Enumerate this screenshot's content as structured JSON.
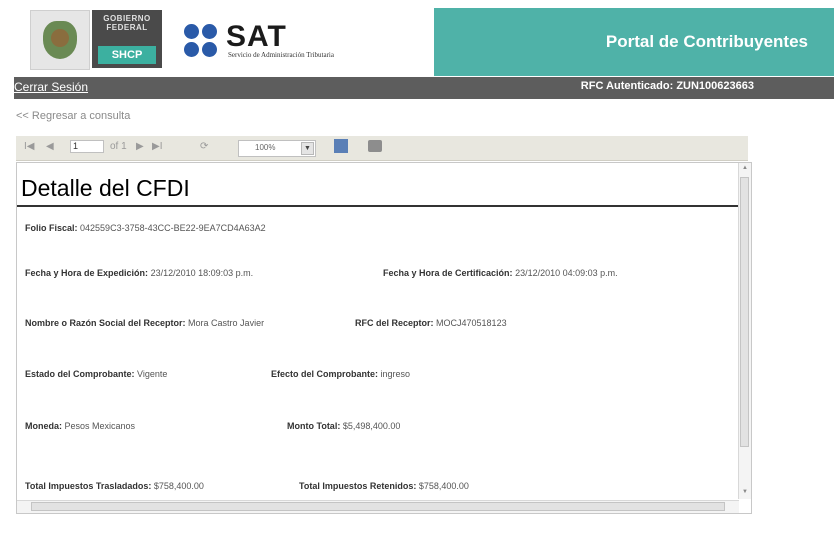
{
  "header": {
    "gov_text": "GOBIERNO FEDERAL",
    "shcp": "SHCP",
    "sat_logo": "SAT",
    "sat_subtitle": "Servicio de Administración Tributaria",
    "portal_title": "Portal de Contribuyentes"
  },
  "auth_bar": {
    "logout": "Cerrar Sesión",
    "rfc_authenticated": "RFC Autenticado: ZUN100623663"
  },
  "back_link": "<< Regresar a consulta",
  "toolbar": {
    "first": "I◀",
    "prev": "◀",
    "page_value": "1",
    "page_of": "of 1",
    "next": "▶",
    "last": "▶I",
    "refresh": "⟳",
    "zoom": "100%",
    "icons": [
      "first-page-icon",
      "prev-page-icon",
      "next-page-icon",
      "last-page-icon",
      "refresh-icon",
      "save-icon",
      "print-icon"
    ]
  },
  "report": {
    "title": "Detalle del CFDI",
    "folio": {
      "label": "Folio Fiscal:",
      "value": "042559C3-3758-43CC-BE22-9EA7CD4A63A2"
    },
    "fecha_expedicion": {
      "label": "Fecha y Hora de Expedición:",
      "value": "23/12/2010 18:09:03 p.m."
    },
    "fecha_certificacion": {
      "label": "Fecha y Hora de Certificación:",
      "value": "23/12/2010 04:09:03 p.m."
    },
    "nombre_receptor": {
      "label": "Nombre o Razón Social del Receptor:",
      "value": "Mora Castro Javier"
    },
    "rfc_receptor": {
      "label": "RFC del Receptor:",
      "value": "MOCJ470518123"
    },
    "estado": {
      "label": "Estado del Comprobante:",
      "value": "Vigente"
    },
    "efecto": {
      "label": "Efecto del Comprobante:",
      "value": "ingreso"
    },
    "moneda": {
      "label": "Moneda:",
      "value": "Pesos Mexicanos"
    },
    "monto": {
      "label": "Monto Total:",
      "value": "$5,498,400.00"
    },
    "traslados": {
      "label": "Total Impuestos Trasladados:",
      "value": "$758,400.00"
    },
    "retenidos": {
      "label": "Total Impuestos Retenidos:",
      "value": "$758,400.00"
    }
  },
  "colors": {
    "portal_teal": "#4fb2a8",
    "auth_bar": "#5d5d5d",
    "toolbar": "#e8e7df"
  }
}
